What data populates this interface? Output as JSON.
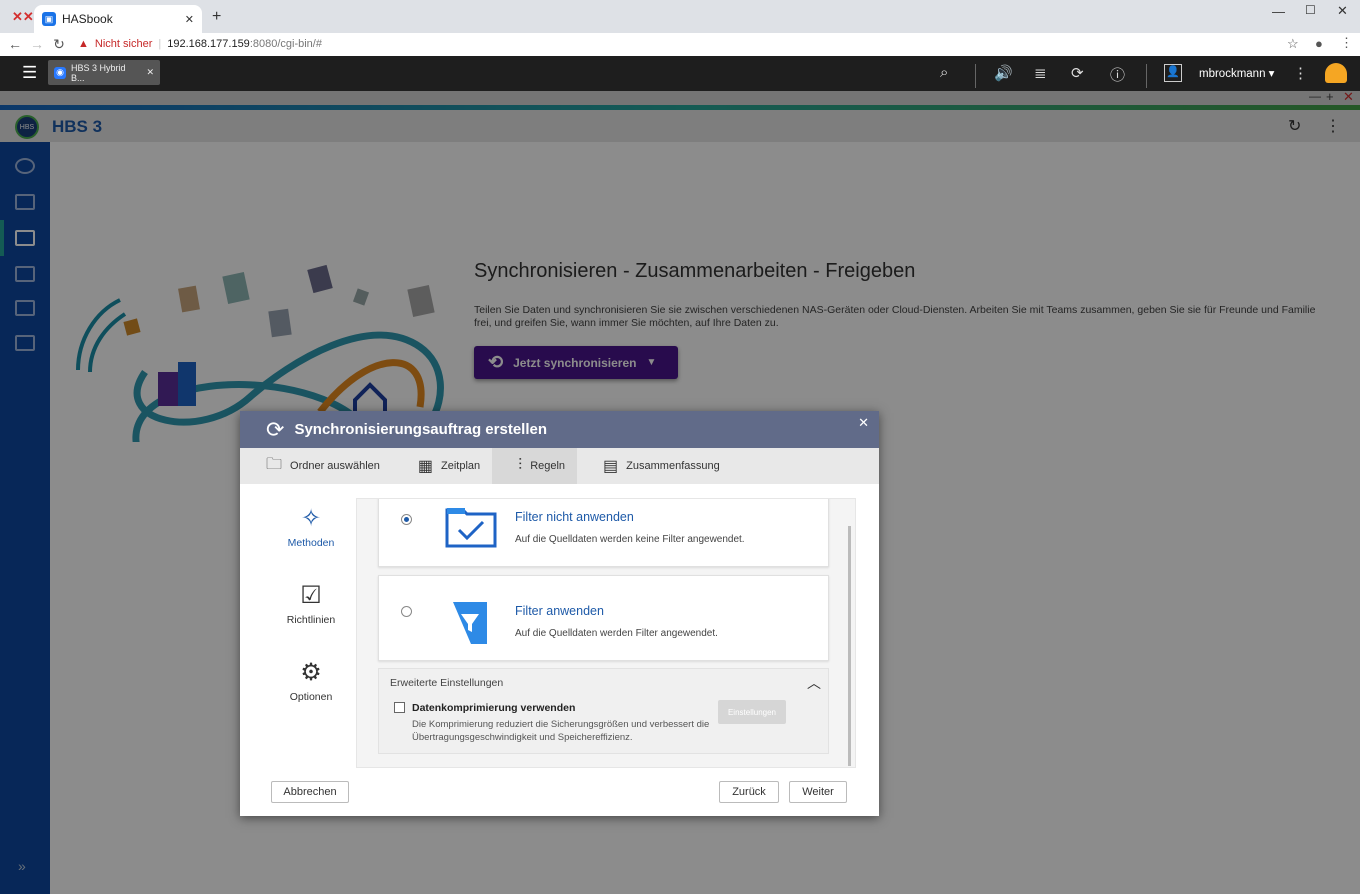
{
  "browser": {
    "tab_title": "HASbook",
    "security_label": "Nicht sicher",
    "url_host": "192.168.177.159",
    "url_rest": ":8080/cgi-bin/#"
  },
  "qts": {
    "app_tab": "HBS 3 Hybrid B...",
    "user": "mbrockmann ▾"
  },
  "app": {
    "name": "HBS 3"
  },
  "hero": {
    "title": "Synchronisieren - Zusammenarbeiten - Freigeben",
    "description": "Teilen Sie Daten und synchronisieren Sie sie zwischen verschiedenen NAS-Geräten oder Cloud-Diensten. Arbeiten Sie mit Teams zusammen, geben Sie sie für Freunde und Familie frei, und greifen Sie, wann immer Sie möchten, auf Ihre Daten zu.",
    "button": "Jetzt synchronisieren"
  },
  "dialog": {
    "title": "Synchronisierungsauftrag erstellen",
    "steps": [
      "Ordner auswählen",
      "Zeitplan",
      "Regeln",
      "Zusammenfassung"
    ],
    "active_step": "Regeln",
    "nav": [
      "Methoden",
      "Richtlinien",
      "Optionen"
    ],
    "options": [
      {
        "title": "Filter nicht anwenden",
        "desc": "Auf die Quelldaten werden keine Filter angewendet.",
        "selected": true
      },
      {
        "title": "Filter anwenden",
        "desc": "Auf die Quelldaten werden Filter angewendet.",
        "selected": false
      }
    ],
    "advanced": {
      "title": "Erweiterte Einstellungen",
      "checkbox_label": "Datenkomprimierung verwenden",
      "checkbox_desc": "Die Komprimierung reduziert die Sicherungsgrößen und verbessert die Übertragungsgeschwindigkeit und Speichereffizienz.",
      "settings_btn": "Einstellungen"
    },
    "buttons": {
      "cancel": "Abbrechen",
      "back": "Zurück",
      "next": "Weiter"
    }
  },
  "colors": {
    "accent": "#1e5aa8",
    "sync_button": "#4a148c",
    "sidebar": "#0d47a1"
  }
}
